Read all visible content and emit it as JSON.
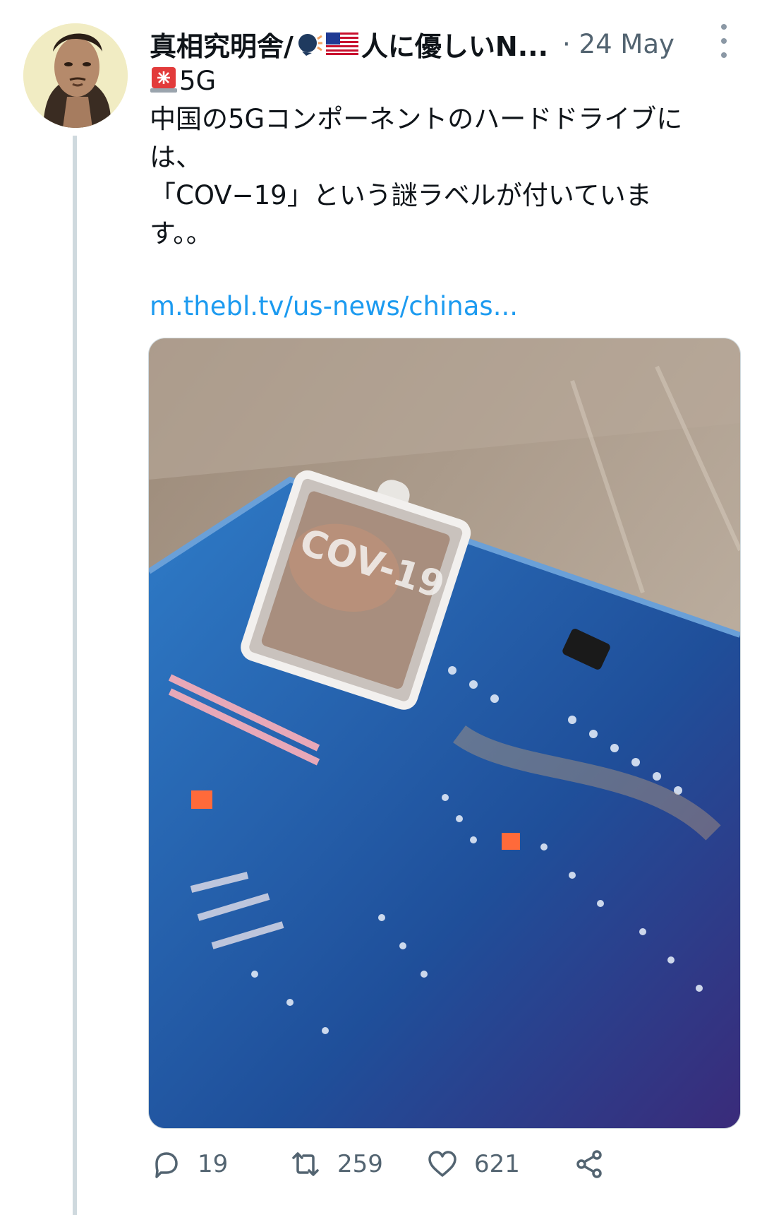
{
  "tweet": {
    "author_name": "真相究明舎/",
    "author_name_tail": "人に優しいN...",
    "date_separator": "·",
    "date": "24 May",
    "lines": [
      "5G",
      "中国の5Gコンポーネントのハードドライブに",
      "は、",
      "「COV−19」という謎ラベルが付いていま",
      "す。。"
    ],
    "link": "m.thebl.tv/us-news/chinas...",
    "media_label": "COV-19",
    "icons": {
      "avatar": "avatar",
      "speaking": "speaking-head-icon",
      "flag": "us-flag-icon",
      "siren": "siren-icon",
      "more": "more-icon"
    }
  },
  "actions": {
    "replies": "19",
    "retweets": "259",
    "likes": "621",
    "icons": [
      "reply-icon",
      "retweet-icon",
      "like-icon",
      "share-icon"
    ]
  },
  "colors": {
    "link": "#1d9bf0",
    "muted": "#536471",
    "thread_line": "#cfd9de"
  }
}
